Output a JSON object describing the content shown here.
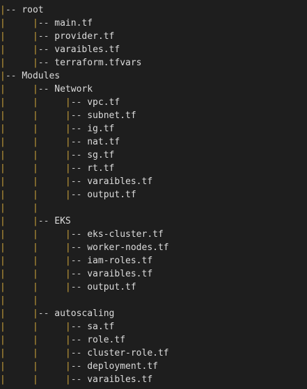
{
  "theme": {
    "background": "#1e1e1e",
    "text_color": "#dcdcdc",
    "guide_color": "#c8a03a"
  },
  "tree": [
    {
      "guide": "|",
      "prefix": "-- ",
      "name": "root"
    },
    {
      "guide": "|     |",
      "prefix": "-- ",
      "name": "main.tf"
    },
    {
      "guide": "|     |",
      "prefix": "-- ",
      "name": "provider.tf"
    },
    {
      "guide": "|     |",
      "prefix": "-- ",
      "name": "varaibles.tf"
    },
    {
      "guide": "|     |",
      "prefix": "-- ",
      "name": "terraform.tfvars"
    },
    {
      "guide": "|",
      "prefix": "-- ",
      "name": "Modules"
    },
    {
      "guide": "|     |",
      "prefix": "-- ",
      "name": "Network"
    },
    {
      "guide": "|     |     |",
      "prefix": "-- ",
      "name": "vpc.tf"
    },
    {
      "guide": "|     |     |",
      "prefix": "-- ",
      "name": "subnet.tf"
    },
    {
      "guide": "|     |     |",
      "prefix": "-- ",
      "name": "ig.tf"
    },
    {
      "guide": "|     |     |",
      "prefix": "-- ",
      "name": "nat.tf"
    },
    {
      "guide": "|     |     |",
      "prefix": "-- ",
      "name": "sg.tf"
    },
    {
      "guide": "|     |     |",
      "prefix": "-- ",
      "name": "rt.tf"
    },
    {
      "guide": "|     |     |",
      "prefix": "-- ",
      "name": "varaibles.tf"
    },
    {
      "guide": "|     |     |",
      "prefix": "-- ",
      "name": "output.tf"
    },
    {
      "guide": "|     |",
      "prefix": "",
      "name": ""
    },
    {
      "guide": "|     |",
      "prefix": "-- ",
      "name": "EKS"
    },
    {
      "guide": "|     |     |",
      "prefix": "-- ",
      "name": "eks-cluster.tf"
    },
    {
      "guide": "|     |     |",
      "prefix": "-- ",
      "name": "worker-nodes.tf"
    },
    {
      "guide": "|     |     |",
      "prefix": "-- ",
      "name": "iam-roles.tf"
    },
    {
      "guide": "|     |     |",
      "prefix": "-- ",
      "name": "varaibles.tf"
    },
    {
      "guide": "|     |     |",
      "prefix": "-- ",
      "name": "output.tf"
    },
    {
      "guide": "|     |",
      "prefix": "",
      "name": ""
    },
    {
      "guide": "|     |",
      "prefix": "-- ",
      "name": "autoscaling"
    },
    {
      "guide": "|     |     |",
      "prefix": "-- ",
      "name": "sa.tf"
    },
    {
      "guide": "|     |     |",
      "prefix": "-- ",
      "name": "role.tf"
    },
    {
      "guide": "|     |     |",
      "prefix": "-- ",
      "name": "cluster-role.tf"
    },
    {
      "guide": "|     |     |",
      "prefix": "-- ",
      "name": "deployment.tf"
    },
    {
      "guide": "|     |     |",
      "prefix": "-- ",
      "name": "varaibles.tf"
    }
  ]
}
